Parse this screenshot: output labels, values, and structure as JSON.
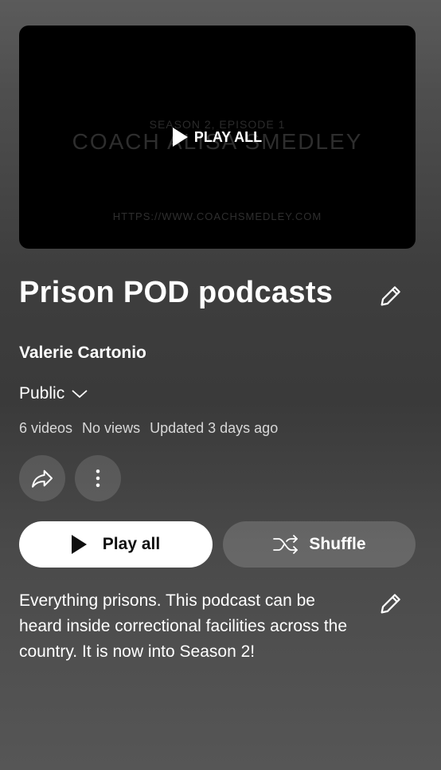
{
  "thumbnail": {
    "episode_text": "SEASON 2, EPISODE 1",
    "coach_text": "COACH ALISA SMEDLEY",
    "url_text": "HTTPS://WWW.COACHSMEDLEY.COM",
    "play_all_label": "PLAY ALL"
  },
  "playlist": {
    "title": "Prison POD podcasts",
    "owner": "Valerie Cartonio",
    "privacy": "Public",
    "video_count": "6 videos",
    "views": "No views",
    "updated": "Updated 3 days ago",
    "description": "Everything prisons. This podcast can be heard inside correctional facilities across the country. It is now into Season 2!"
  },
  "actions": {
    "play_all_label": "Play all",
    "shuffle_label": "Shuffle"
  },
  "icons": {
    "edit": "pencil-icon",
    "share": "share-icon",
    "more": "more-vertical-icon",
    "chevron": "chevron-down-icon",
    "play": "play-icon",
    "shuffle": "shuffle-icon"
  }
}
